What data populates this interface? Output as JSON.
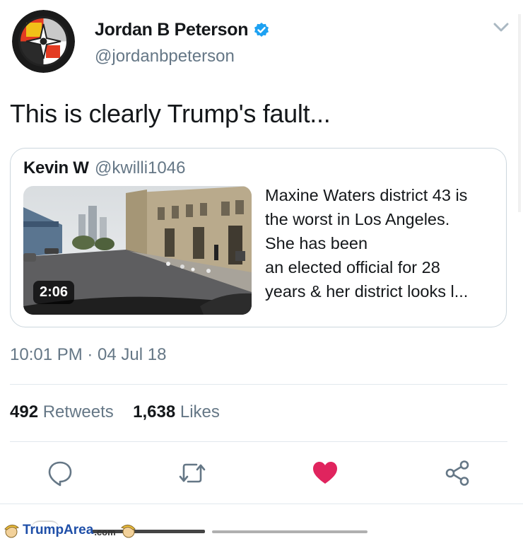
{
  "author": {
    "display_name": "Jordan B Peterson",
    "handle": "@jordanbpeterson"
  },
  "tweet": {
    "text": "This is clearly Trump's fault..."
  },
  "quoted_tweet": {
    "author_name": "Kevin W",
    "author_handle": "@kwilli1046",
    "video_duration": "2:06",
    "text_lines": [
      "Maxine Waters district 43 is",
      "the worst in Los Angeles.",
      "She has been",
      "an elected official for 28",
      "years & her district looks l..."
    ]
  },
  "meta": {
    "timestamp": "10:01 PM · 04 Jul 18"
  },
  "stats": {
    "retweets_count": "492",
    "retweets_label": "Retweets",
    "likes_count": "1,638",
    "likes_label": "Likes"
  },
  "actions": [
    {
      "icon": "reply-icon"
    },
    {
      "icon": "retweet-icon"
    },
    {
      "icon": "heart-icon",
      "active": true
    },
    {
      "icon": "share-icon"
    }
  ],
  "watermark": {
    "text_primary": "TrumpArea",
    "text_suffix": ".com"
  },
  "colors": {
    "verified_blue": "#1da1f2",
    "secondary_text": "#657786",
    "like_red": "#e0245e",
    "action_gray": "#657786"
  }
}
